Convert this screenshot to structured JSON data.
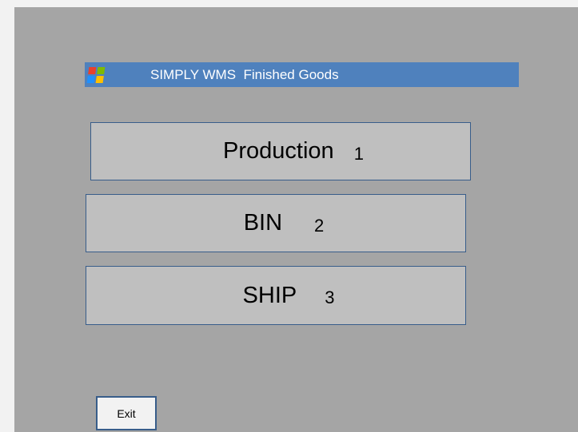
{
  "titlebar": {
    "icon": "windows-logo-icon",
    "title": "SIMPLY WMS  Finished Goods"
  },
  "menu": [
    {
      "label": "Production",
      "number": "1"
    },
    {
      "label": "BIN",
      "number": "2"
    },
    {
      "label": "SHIP",
      "number": "3"
    }
  ],
  "exit_label": "Exit",
  "colors": {
    "panel_bg": "#a5a5a5",
    "titlebar_bg": "#4f81bd",
    "button_bg": "#bfbfbf",
    "button_border": "#385d8a",
    "exit_bg": "#f2f2f2"
  }
}
